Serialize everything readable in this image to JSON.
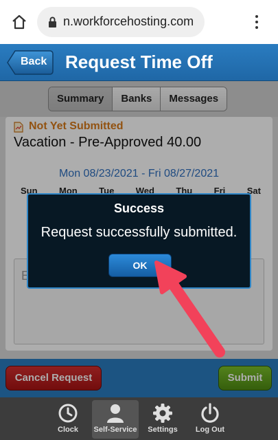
{
  "browser": {
    "url": "n.workforcehosting.com",
    "icons": {
      "home": "home-icon",
      "lock": "lock-icon",
      "menu": "kebab-menu-icon"
    }
  },
  "header": {
    "back_label": "Back",
    "title": "Request Time Off"
  },
  "tabs": [
    {
      "label": "Summary",
      "active": true
    },
    {
      "label": "Banks",
      "active": false
    },
    {
      "label": "Messages",
      "active": false
    }
  ],
  "request": {
    "status": "Not Yet Submitted",
    "type_and_hours": "Vacation - Pre-Approved  40.00",
    "date_range": "Mon 08/23/2021 - Fri 08/27/2021",
    "weekdays": [
      "Sun",
      "Mon",
      "Tue",
      "Wed",
      "Thu",
      "Fri",
      "Sat"
    ],
    "notes_initial": "E"
  },
  "actions": {
    "cancel_label": "Cancel Request",
    "submit_label": "Submit"
  },
  "bottom_nav": [
    {
      "label": "Clock",
      "icon": "clock-icon"
    },
    {
      "label": "Self-Service",
      "icon": "person-icon",
      "active": true
    },
    {
      "label": "Settings",
      "icon": "gear-icon"
    },
    {
      "label": "Log Out",
      "icon": "power-icon"
    }
  ],
  "dialog": {
    "title": "Success",
    "message": "Request successfully submitted.",
    "ok_label": "OK"
  },
  "colors": {
    "header_blue": "#2a7cc0",
    "status_orange": "#d77a1a",
    "date_blue": "#2f6fbf",
    "cancel_red": "#c62828",
    "submit_green": "#66a820",
    "arrow_red": "#f2425a"
  }
}
